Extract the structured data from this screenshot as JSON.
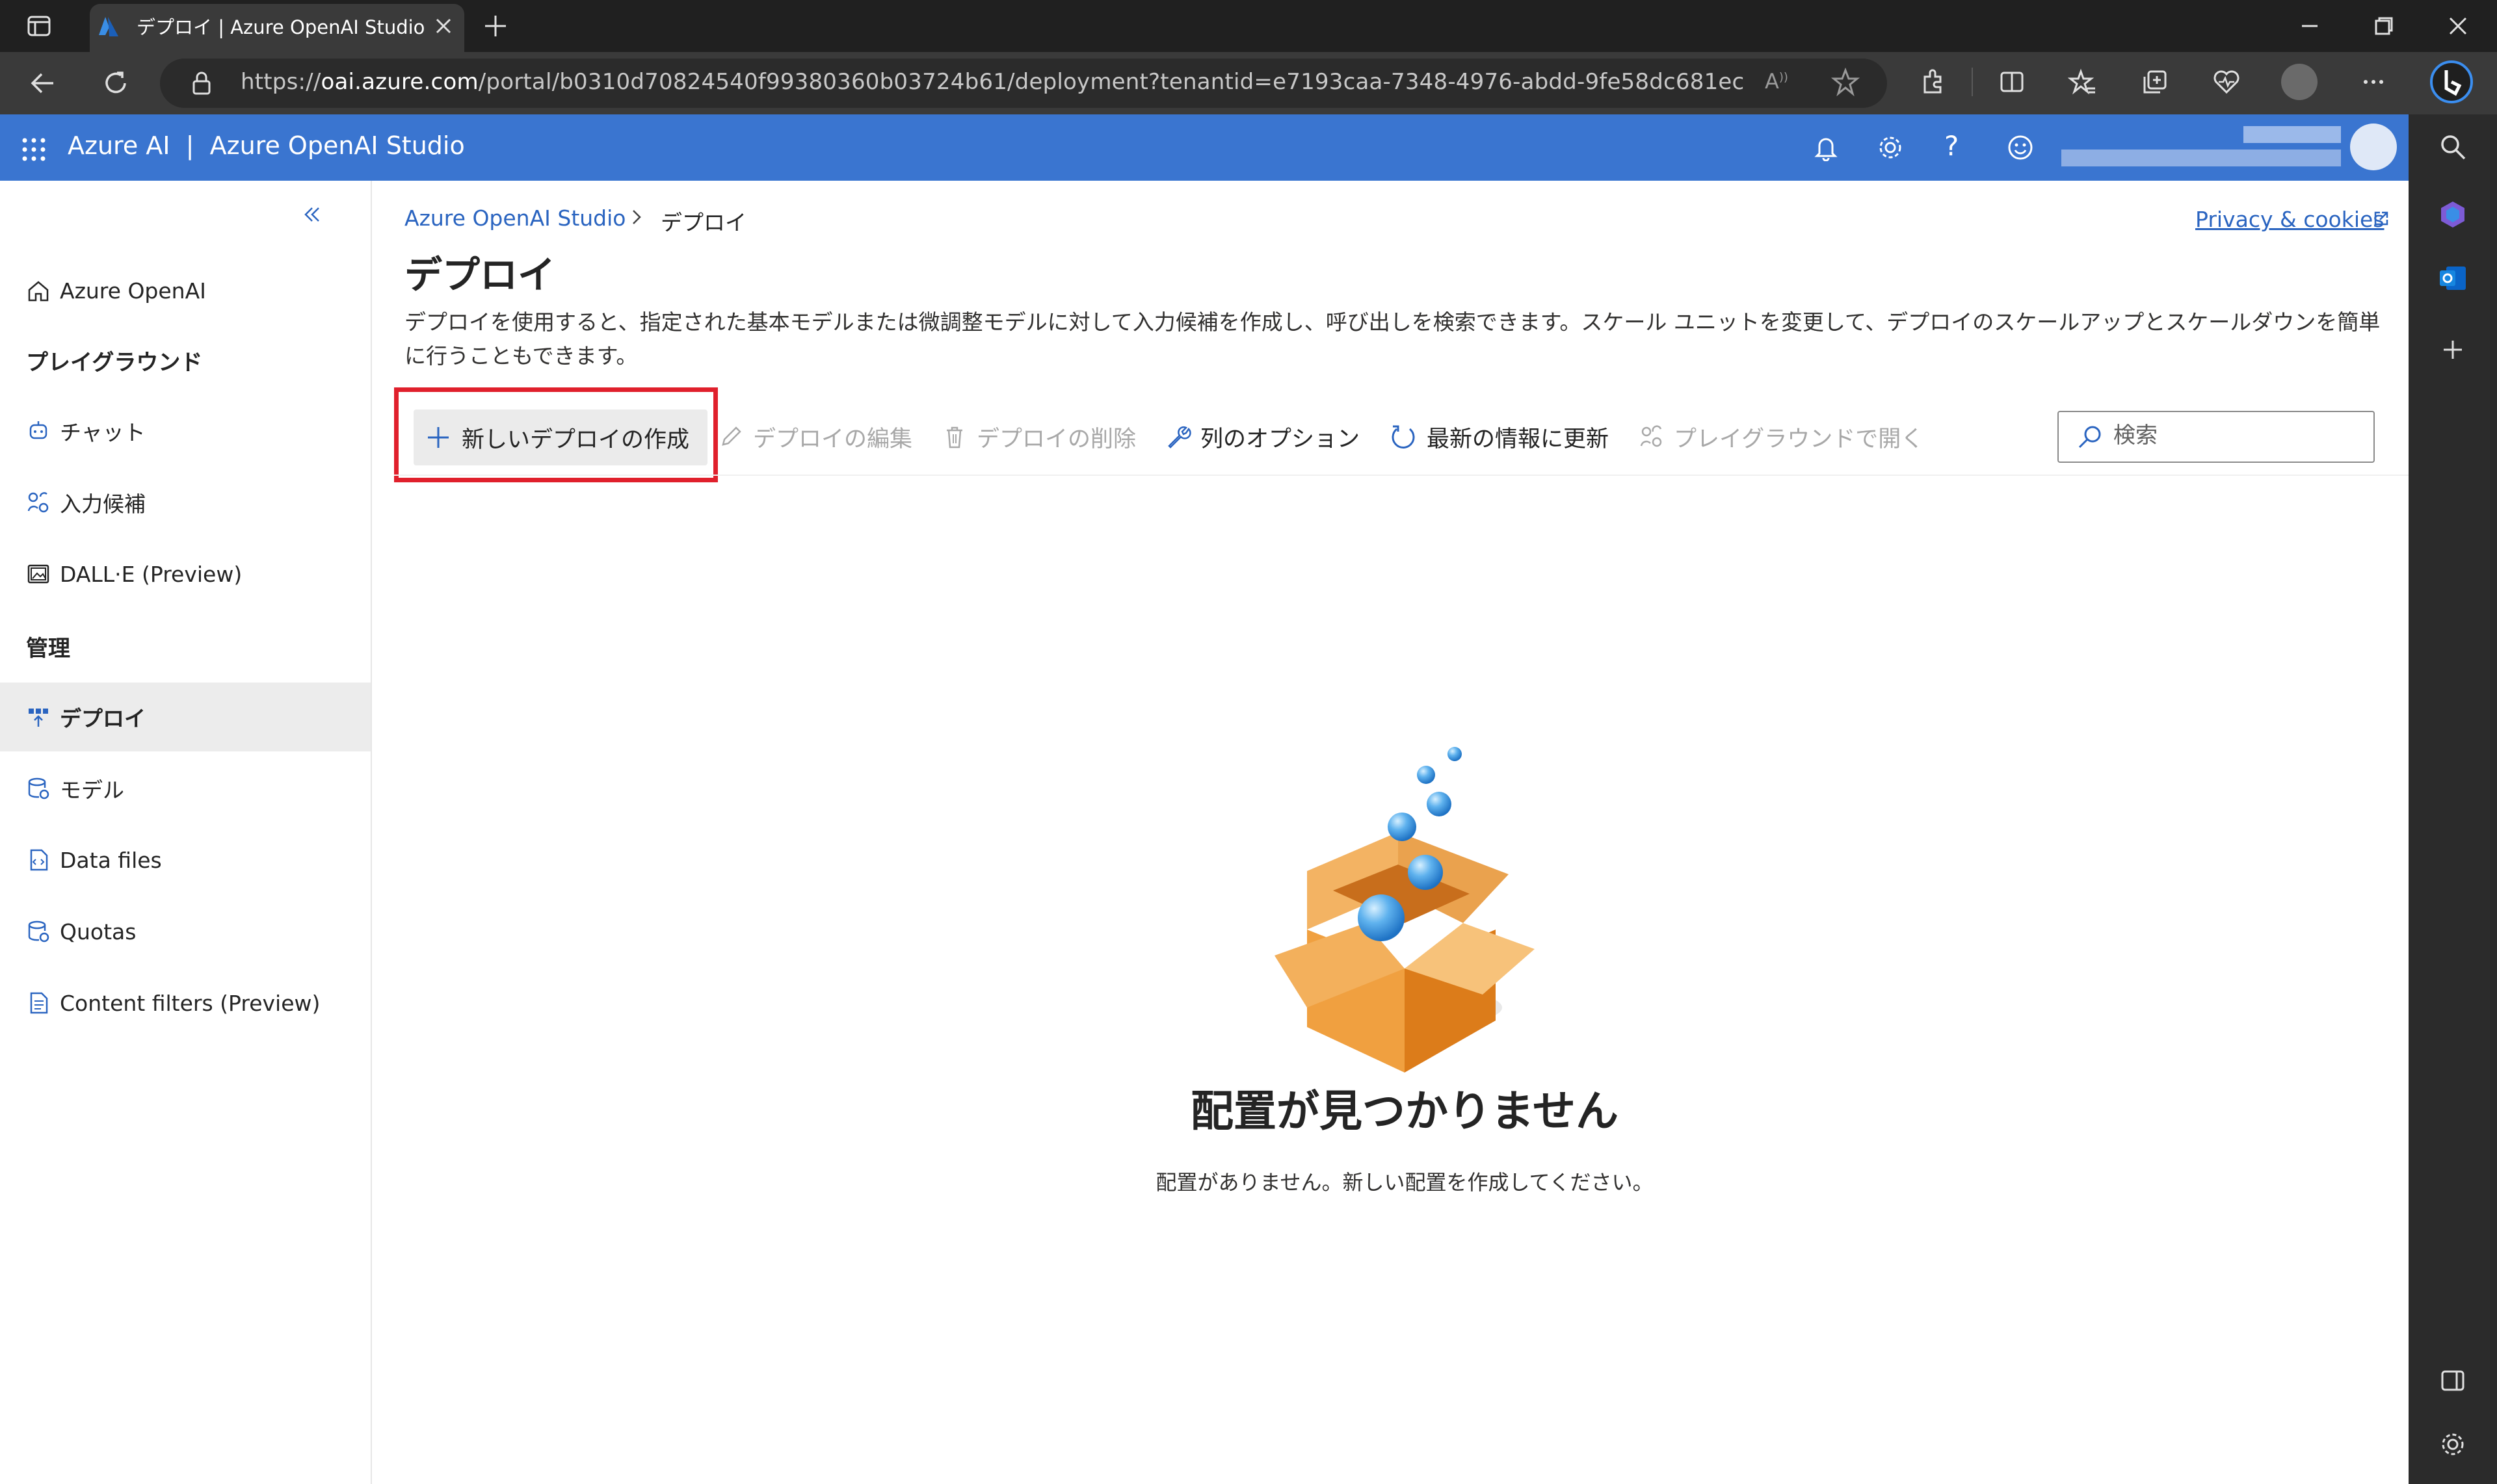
{
  "browser": {
    "tab_title": "デプロイ | Azure OpenAI Studio",
    "url_prefix": "https://",
    "url_host": "oai.azure.com",
    "url_path": "/portal/b0310d70824540f99380360b03724b61/deployment?tenantid=e7193caa-7348-4976-abdd-9fe58dc681ec"
  },
  "header": {
    "brand": "Azure AI",
    "separator": "|",
    "product": "Azure OpenAI Studio"
  },
  "nav": {
    "collapse_icon": "double-chevron-left-icon",
    "home_label": "Azure OpenAI",
    "section_playground": "プレイグラウンド",
    "chat_label": "チャット",
    "completions_label": "入力候補",
    "dalle_label": "DALL·E (Preview)",
    "section_manage": "管理",
    "deploy_label": "デプロイ",
    "models_label": "モデル",
    "datafiles_label": "Data files",
    "quotas_label": "Quotas",
    "contentfilters_label": "Content filters (Preview)",
    "selected": "デプロイ"
  },
  "breadcrumb": {
    "root": "Azure OpenAI Studio",
    "current": "デプロイ"
  },
  "privacy_link": "Privacy & cookies",
  "page": {
    "title": "デプロイ",
    "description": "デプロイを使用すると、指定された基本モデルまたは微調整モデルに対して入力候補を作成し、呼び出しを検索できます。スケール ユニットを変更して、デプロイのスケールアップとスケールダウンを簡単に行うこともできます。"
  },
  "commands": {
    "new_deployment": "新しいデプロイの作成",
    "edit_deployment": "デプロイの編集",
    "delete_deployment": "デプロイの削除",
    "column_options": "列のオプション",
    "refresh": "最新の情報に更新",
    "open_playground": "プレイグラウンドで開く"
  },
  "search": {
    "placeholder": "検索"
  },
  "empty_state": {
    "title": "配置が見つかりません",
    "description": "配置がありません。新しい配置を作成してください。"
  },
  "colors": {
    "azure_header": "#3a75d0",
    "link": "#2a64c0",
    "highlight": "#e0202c",
    "box_orange": "#f0a040"
  }
}
